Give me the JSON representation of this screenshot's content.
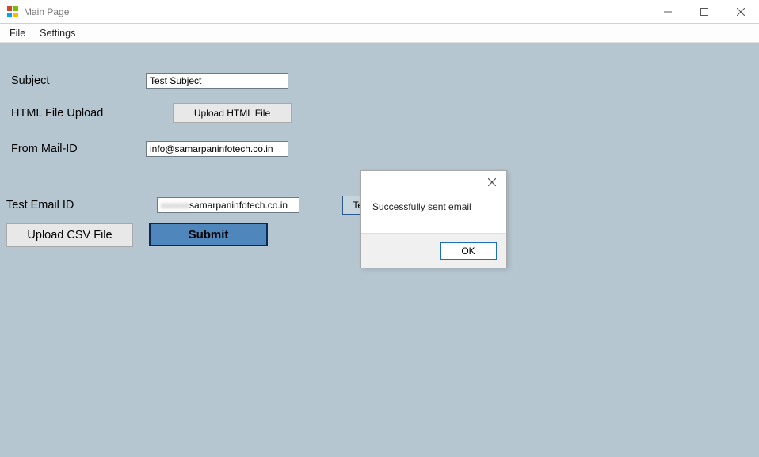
{
  "window": {
    "title": "Main Page"
  },
  "menu": {
    "file": "File",
    "settings": "Settings"
  },
  "form": {
    "subject_label": "Subject",
    "subject_value": "Test Subject",
    "html_upload_label": "HTML File Upload",
    "html_upload_button": "Upload HTML File",
    "from_mail_label": "From Mail-ID",
    "from_mail_value": "info@samarpaninfotech.co.in",
    "test_email_label": "Test Email ID",
    "test_email_prefix_masked": "xxxxxx",
    "test_email_suffix": "samarpaninfotech.co.in",
    "test_send_button": "Test S",
    "upload_csv_button": "Upload CSV File",
    "submit_button": "Submit"
  },
  "dialog": {
    "message": "Successfully sent email",
    "ok": "OK"
  }
}
